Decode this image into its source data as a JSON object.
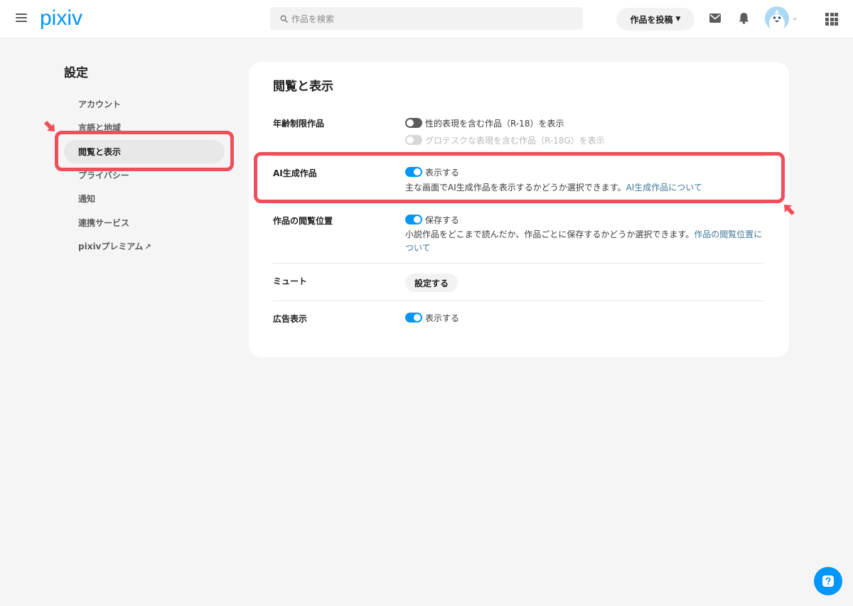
{
  "header": {
    "logo": "pixiv",
    "search_placeholder": "作品を検索",
    "post_button": "作品を投稿"
  },
  "sidebar": {
    "title": "設定",
    "items": [
      {
        "label": "アカウント"
      },
      {
        "label": "言語と地域"
      },
      {
        "label": "閲覧と表示"
      },
      {
        "label": "プライバシー"
      },
      {
        "label": "通知"
      },
      {
        "label": "連携サービス"
      },
      {
        "label": "pixivプレミアム"
      }
    ]
  },
  "main": {
    "title": "閲覧と表示",
    "age_restricted": {
      "label": "年齢制限作品",
      "r18": "性的表現を含む作品（R-18）を表示",
      "r18g": "グロテスクな表現を含む作品（R-18G）を表示"
    },
    "ai": {
      "label": "AI生成作品",
      "toggle": "表示する",
      "desc": "主な画面でAI生成作品を表示するかどうか選択できます。",
      "link": "AI生成作品について"
    },
    "reading_position": {
      "label": "作品の閲覧位置",
      "toggle": "保存する",
      "desc": "小説作品をどこまで読んだか、作品ごとに保存するかどうか選択できます。",
      "link": "作品の閲覧位置について"
    },
    "mute": {
      "label": "ミュート",
      "button": "設定する"
    },
    "ads": {
      "label": "広告表示",
      "toggle": "表示する"
    }
  },
  "colors": {
    "accent": "#0096fa",
    "highlight": "#ef4f5a",
    "link": "#3d7699"
  }
}
